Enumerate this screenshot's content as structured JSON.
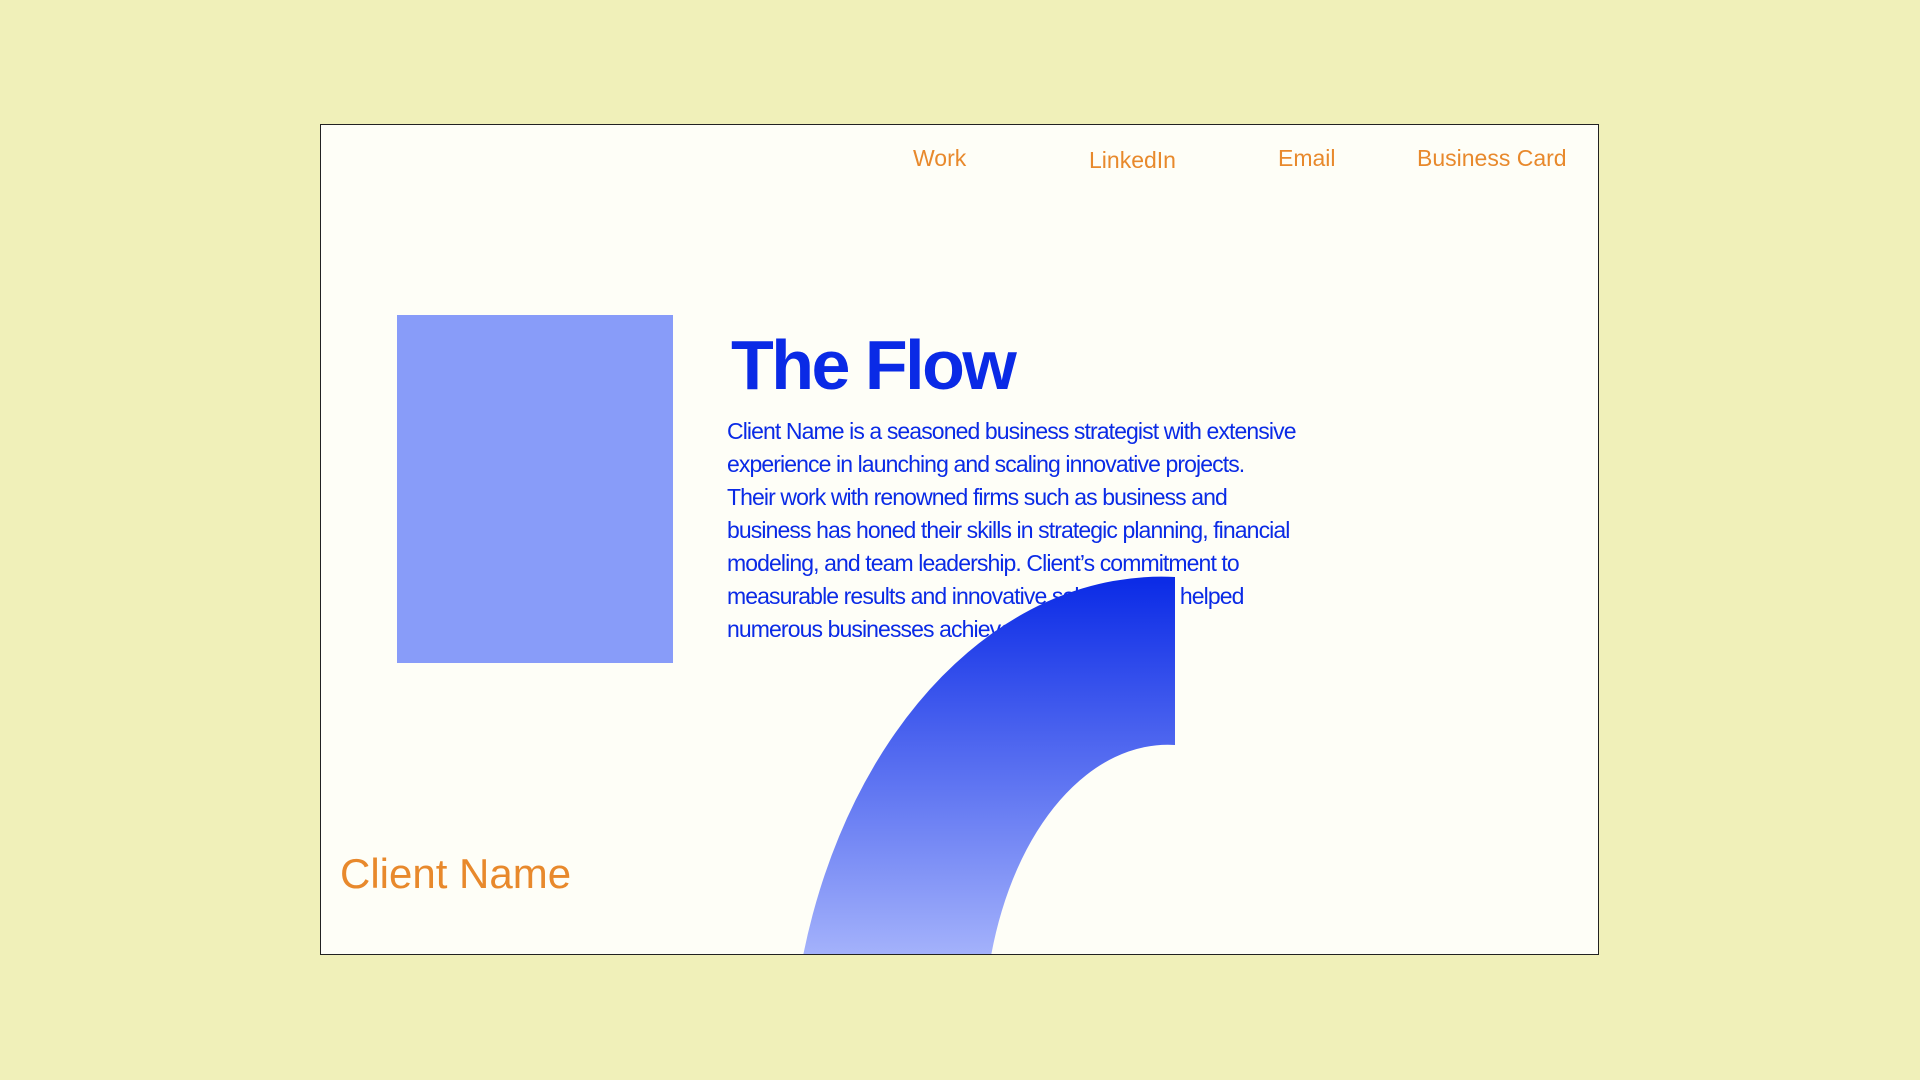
{
  "nav": {
    "work": "Work",
    "linkedin": "LinkedIn",
    "email": "Email",
    "business_card": "Business Card"
  },
  "hero": {
    "title": "The Flow",
    "bio": "Client Name is a seasoned business strategist with extensive experience in launching and scaling innovative projects. Their work with renowned firms such as business and business has honed their skills in strategic planning, financial modeling, and team leadership. Client’s commitment to measurable results and innovative solutions has helped numerous businesses achieve their goals."
  },
  "footer": {
    "client_name": "Client Name"
  },
  "colors": {
    "background": "#f0f0b9",
    "card": "#fefef7",
    "accent_orange": "#e8892c",
    "brand_blue": "#0a2ae6",
    "image_placeholder": "#889cf9",
    "arc_gradient_top": "#0a2ae6",
    "arc_gradient_bottom": "#a4b2fb"
  }
}
